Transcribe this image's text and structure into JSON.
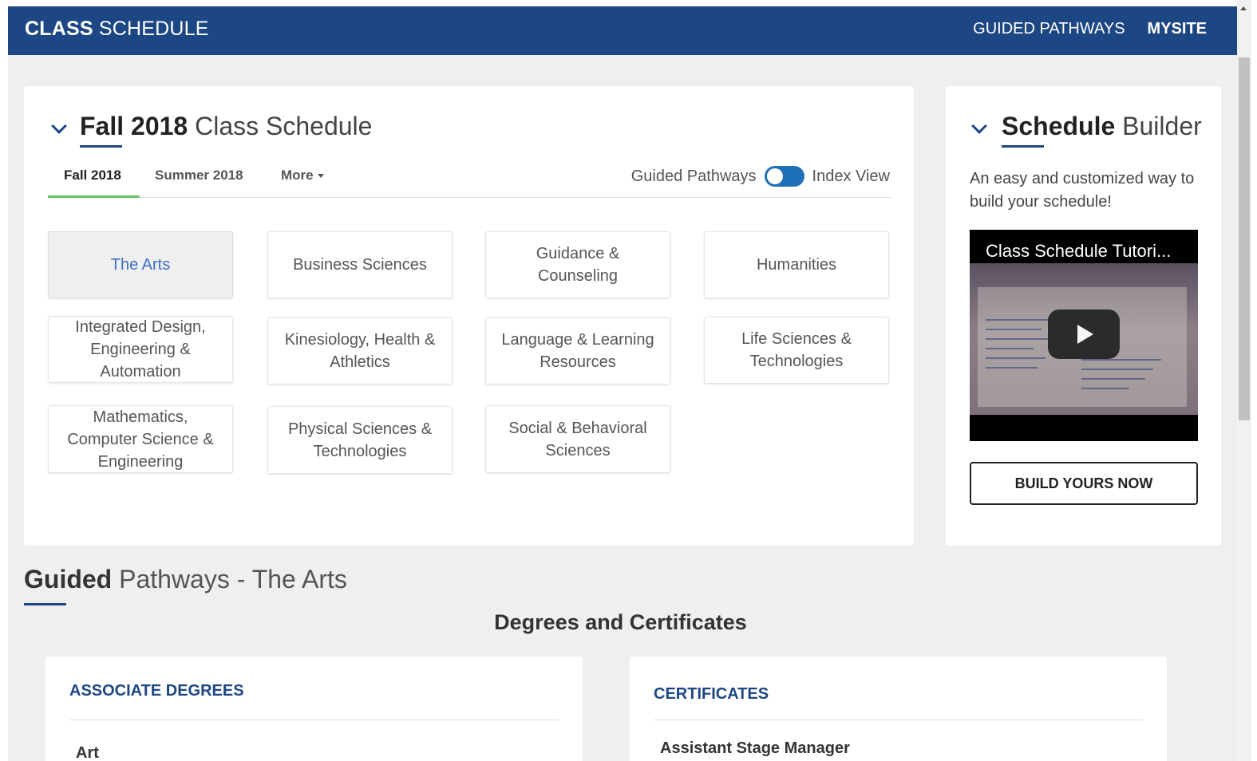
{
  "header": {
    "brand_bold": "CLASS",
    "brand_rest": "SCHEDULE",
    "nav": [
      "GUIDED PATHWAYS",
      "MYSITE"
    ]
  },
  "main_card": {
    "title_bold": "Fall 2018",
    "title_rest": "Class Schedule",
    "tabs": [
      "Fall 2018",
      "Summer 2018",
      "More"
    ],
    "toggle_left": "Guided Pathways",
    "toggle_right": "Index View",
    "tiles": [
      "The Arts",
      "Business Sciences",
      "Guidance & Counseling",
      "Humanities",
      "Integrated Design, Engineering & Automation",
      "Kinesiology, Health & Athletics",
      "Language & Learning Resources",
      "Life Sciences & Technologies",
      "Mathematics, Computer Science & Engineering",
      "Physical Sciences & Technologies",
      "Social & Behavioral Sciences"
    ]
  },
  "side_card": {
    "title_bold": "Schedule",
    "title_rest": "Builder",
    "description": "An easy and customized way to build your schedule!",
    "video_title": "Class Schedule Tutori...",
    "button": "BUILD YOURS NOW"
  },
  "section": {
    "title_bold": "Guided",
    "title_rest": "Pathways - The Arts",
    "subtitle": "Degrees and Certificates",
    "associate": {
      "heading": "ASSOCIATE DEGREES",
      "first_item": "Art"
    },
    "certificates": {
      "heading": "CERTIFICATES",
      "first_item": "Assistant Stage Manager"
    }
  },
  "colors": {
    "brand_blue": "#1d4784",
    "tab_active": "#66c46a",
    "selected_link": "#3b6fc4",
    "toggle": "#1d6fb8"
  }
}
